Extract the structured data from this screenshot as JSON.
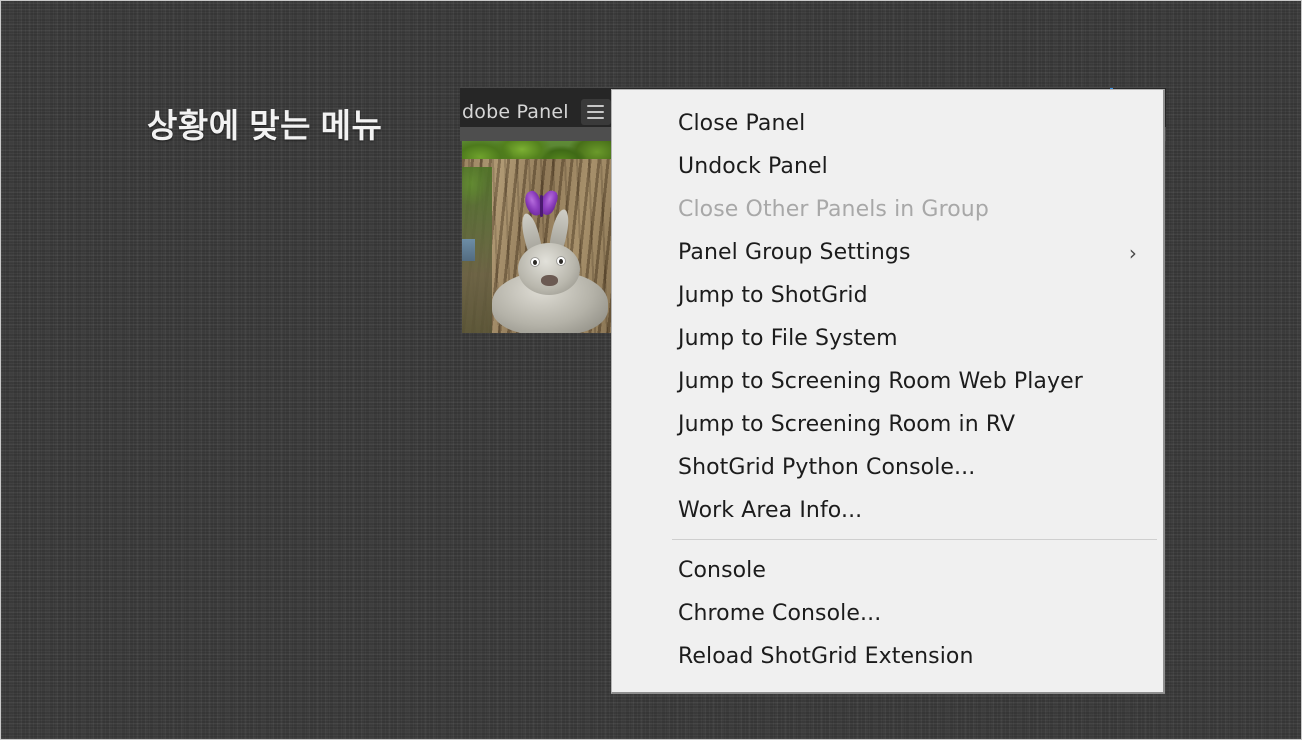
{
  "caption": {
    "text": "상황에 맞는 메뉴"
  },
  "panel": {
    "title": "dobe Panel",
    "menu_button_icon": "hamburger-menu-icon",
    "accent_color": "#3a8fe0",
    "thumbnail_alt": "big-buck-bunny-thumbnail"
  },
  "context_menu": {
    "groups": [
      {
        "items": [
          {
            "label": "Close Panel",
            "disabled": false,
            "submenu": false
          },
          {
            "label": "Undock Panel",
            "disabled": false,
            "submenu": false
          },
          {
            "label": "Close Other Panels in Group",
            "disabled": true,
            "submenu": false
          },
          {
            "label": "Panel Group Settings",
            "disabled": false,
            "submenu": true,
            "arrow": "›"
          },
          {
            "label": "Jump to ShotGrid",
            "disabled": false,
            "submenu": false
          },
          {
            "label": "Jump to File System",
            "disabled": false,
            "submenu": false
          },
          {
            "label": "Jump to Screening Room Web Player",
            "disabled": false,
            "submenu": false
          },
          {
            "label": "Jump to Screening Room in RV",
            "disabled": false,
            "submenu": false
          },
          {
            "label": "ShotGrid Python Console...",
            "disabled": false,
            "submenu": false
          },
          {
            "label": "Work Area Info...",
            "disabled": false,
            "submenu": false
          }
        ]
      },
      {
        "items": [
          {
            "label": "Console",
            "disabled": false,
            "submenu": false
          },
          {
            "label": "Chrome Console...",
            "disabled": false,
            "submenu": false
          },
          {
            "label": "Reload ShotGrid Extension",
            "disabled": false,
            "submenu": false
          }
        ]
      }
    ]
  },
  "colors": {
    "desktop_background": "#3b3b3b",
    "menu_background": "#f0f0f0",
    "panel_chrome": "#262626",
    "menu_text": "#1c1c1c",
    "menu_text_disabled": "#a8a8a8",
    "caption_text": "#f2f2f2"
  }
}
